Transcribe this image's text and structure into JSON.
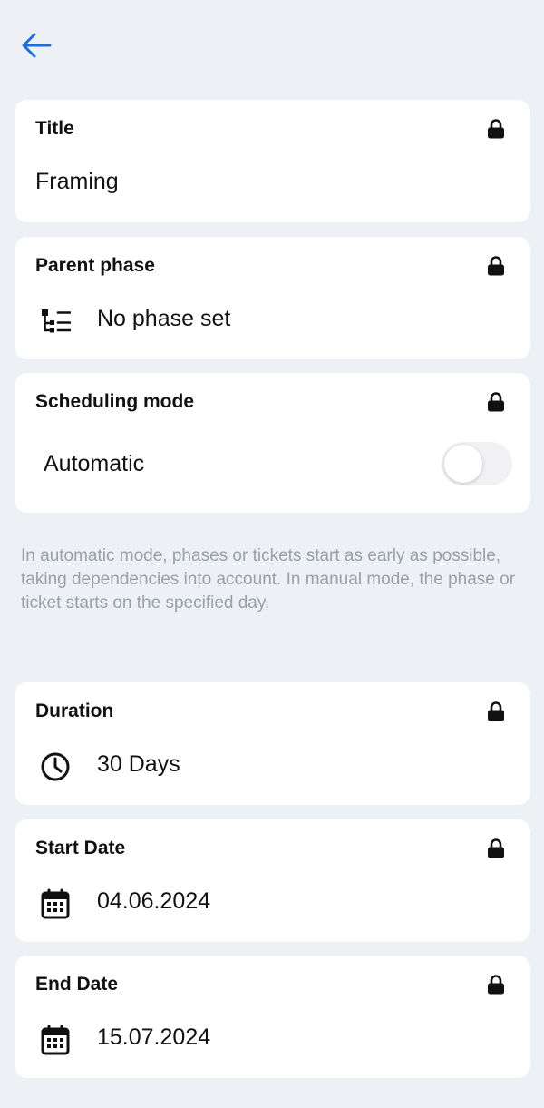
{
  "fields": {
    "title": {
      "label": "Title",
      "value": "Framing"
    },
    "parent_phase": {
      "label": "Parent phase",
      "value": "No phase set",
      "icon": "phase-tree-icon"
    },
    "scheduling_mode": {
      "label": "Scheduling mode",
      "value": "Automatic",
      "toggle_on": false
    },
    "duration": {
      "label": "Duration",
      "value": "30 Days",
      "icon": "clock-icon"
    },
    "start_date": {
      "label": "Start Date",
      "value": "04.06.2024",
      "icon": "calendar-icon"
    },
    "end_date": {
      "label": "End Date",
      "value": "15.07.2024",
      "icon": "calendar-icon"
    }
  },
  "info_text": "In automatic mode, phases or tickets start as early as possible, taking dependencies into account. In manual mode, the phase or ticket starts on the specified day.",
  "colors": {
    "accent": "#1e6fd9",
    "background": "#edf1f6",
    "card": "#ffffff",
    "muted_text": "#9a9fa7"
  }
}
